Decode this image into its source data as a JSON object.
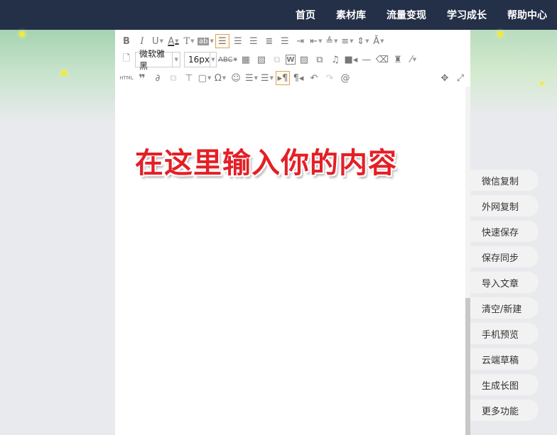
{
  "nav": {
    "items": [
      "首页",
      "素材库",
      "流量变现",
      "学习成长",
      "帮助中心"
    ]
  },
  "toolbar": {
    "font_family": "微软雅黑",
    "font_size": "16px",
    "html_label": "HTML"
  },
  "editor": {
    "content": "在这里输入你的内容"
  },
  "side": {
    "buttons": [
      "微信复制",
      "外网复制",
      "快速保存",
      "保存同步",
      "导入文章",
      "清空/新建",
      "手机预览",
      "云端草稿",
      "生成长图",
      "更多功能"
    ]
  },
  "colors": {
    "nav_bg": "#243048",
    "headline": "#e41f26",
    "accent": "#d9a65a"
  }
}
